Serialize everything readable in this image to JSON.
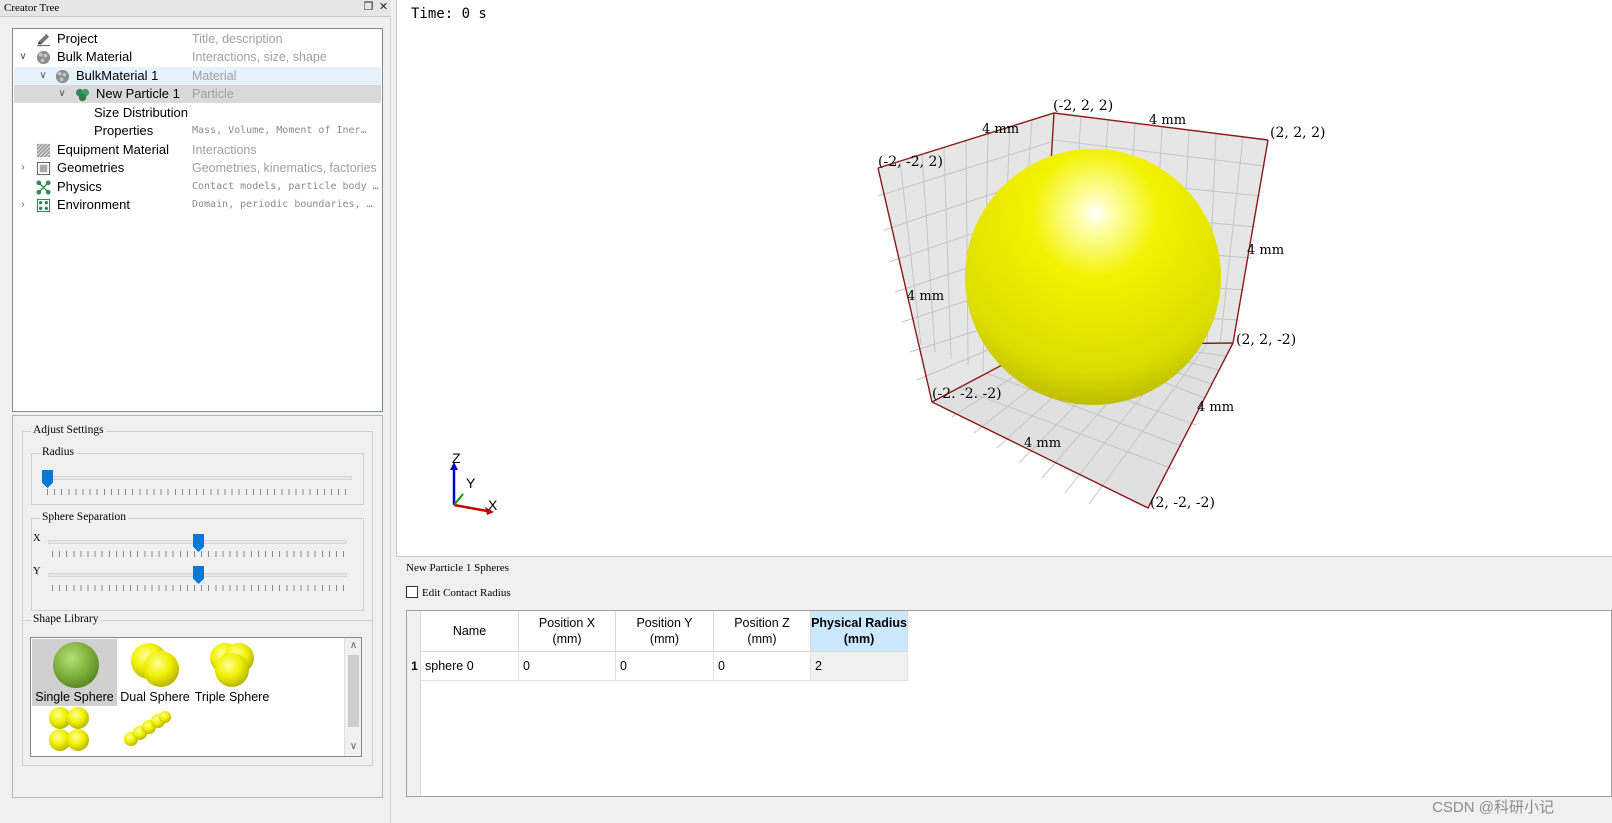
{
  "dock": {
    "title": "Creator Tree"
  },
  "tree": [
    {
      "label": "Project",
      "desc": "Title, description",
      "icon": "pencil-icon"
    },
    {
      "label": "Bulk Material",
      "desc": "Interactions, size, shape",
      "icon": "bulk-material-icon"
    },
    {
      "label": "BulkMaterial 1",
      "desc": "Material",
      "icon": "material-icon"
    },
    {
      "label": "New Particle 1",
      "desc": "Particle",
      "icon": "particle-icon"
    },
    {
      "label": "Size Distribution",
      "desc": ""
    },
    {
      "label": "Properties",
      "desc": "Mass, Volume, Moment of Iner…"
    },
    {
      "label": "Equipment Material",
      "desc": "Interactions",
      "icon": "equipment-icon"
    },
    {
      "label": "Geometries",
      "desc": "Geometries, kinematics, factories",
      "icon": "geometries-icon"
    },
    {
      "label": "Physics",
      "desc": "Contact models, particle body …",
      "icon": "physics-icon"
    },
    {
      "label": "Environment",
      "desc": "Domain, periodic boundaries, …",
      "icon": "environment-icon"
    }
  ],
  "settings": {
    "adjust_title": "Adjust Settings",
    "radius_title": "Radius",
    "separation_title": "Sphere Separation",
    "x_label": "X",
    "y_label": "Y",
    "radius_value": 0.0,
    "x_value": 0.5,
    "y_value": 0.5,
    "shape_library_title": "Shape Library"
  },
  "shapes": [
    {
      "label": "Single Sphere",
      "selected": true
    },
    {
      "label": "Dual Sphere"
    },
    {
      "label": "Triple Sphere"
    },
    {
      "label": ""
    },
    {
      "label": ""
    }
  ],
  "viewport": {
    "time": "Time: 0 s",
    "corners": {
      "c1": "(-2, 2, 2)",
      "c2": "(2, 2, 2)",
      "c3": "(-2, -2, 2)",
      "c4": "(2, 2, -2)",
      "c5": "(-2. -2. -2)",
      "c6": "(2, -2, -2)"
    },
    "axis_label": "4 mm",
    "triad": {
      "z": "Z",
      "y": "Y",
      "x": "X"
    }
  },
  "spheres": {
    "title": "New Particle 1 Spheres",
    "edit_contact": "Edit Contact Radius",
    "columns": [
      "Name",
      "Position X\n(mm)",
      "Position Y\n(mm)",
      "Position Z\n(mm)",
      "Physical Radius\n(mm)"
    ],
    "rows": [
      {
        "index": "1",
        "name": "sphere 0",
        "x": "0",
        "y": "0",
        "z": "0",
        "r": "2"
      }
    ]
  },
  "watermark": "CSDN @科研小记",
  "colors": {
    "sphere": "#e6e600",
    "frame": "#8b1a1a",
    "accent": "#0078d7"
  }
}
